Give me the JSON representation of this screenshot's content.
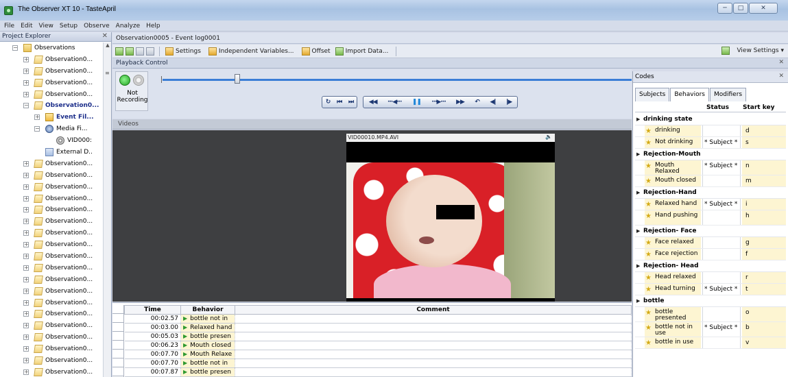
{
  "window": {
    "title": "The Observer XT 10 - TasteApril"
  },
  "menu": [
    "File",
    "Edit",
    "View",
    "Setup",
    "Observe",
    "Analyze",
    "Help"
  ],
  "explorer": {
    "title": "Project Explorer",
    "tree": [
      {
        "label": "Observations",
        "indent": 0,
        "exp": "minus",
        "icon": "folder"
      },
      {
        "label": "Observation0...",
        "indent": 1,
        "exp": "plus",
        "icon": "obs"
      },
      {
        "label": "Observation0...",
        "indent": 1,
        "exp": "plus",
        "icon": "obs"
      },
      {
        "label": "Observation0...",
        "indent": 1,
        "exp": "plus",
        "icon": "obs"
      },
      {
        "label": "Observation0...",
        "indent": 1,
        "exp": "plus",
        "icon": "obs"
      },
      {
        "label": "Observation0...",
        "indent": 1,
        "exp": "minus",
        "icon": "obs",
        "bold": true
      },
      {
        "label": "Event Fil...",
        "indent": 2,
        "exp": "plus",
        "icon": "ev",
        "bold": true
      },
      {
        "label": "Media Fi...",
        "indent": 2,
        "exp": "minus",
        "icon": "media"
      },
      {
        "label": "VID000:",
        "indent": 3,
        "exp": "",
        "icon": "vid"
      },
      {
        "label": "External D..",
        "indent": 2,
        "exp": "",
        "icon": "ext"
      },
      {
        "label": "Observation0...",
        "indent": 1,
        "exp": "plus",
        "icon": "obs"
      },
      {
        "label": "Observation0...",
        "indent": 1,
        "exp": "plus",
        "icon": "obs"
      },
      {
        "label": "Observation0...",
        "indent": 1,
        "exp": "plus",
        "icon": "obs"
      },
      {
        "label": "Observation0...",
        "indent": 1,
        "exp": "plus",
        "icon": "obs"
      },
      {
        "label": "Observation0...",
        "indent": 1,
        "exp": "plus",
        "icon": "obs"
      },
      {
        "label": "Observation0...",
        "indent": 1,
        "exp": "plus",
        "icon": "obs"
      },
      {
        "label": "Observation0...",
        "indent": 1,
        "exp": "plus",
        "icon": "obs"
      },
      {
        "label": "Observation0...",
        "indent": 1,
        "exp": "plus",
        "icon": "obs"
      },
      {
        "label": "Observation0...",
        "indent": 1,
        "exp": "plus",
        "icon": "obs"
      },
      {
        "label": "Observation0...",
        "indent": 1,
        "exp": "plus",
        "icon": "obs"
      },
      {
        "label": "Observation0...",
        "indent": 1,
        "exp": "plus",
        "icon": "obs"
      },
      {
        "label": "Observation0...",
        "indent": 1,
        "exp": "plus",
        "icon": "obs"
      },
      {
        "label": "Observation0...",
        "indent": 1,
        "exp": "plus",
        "icon": "obs"
      },
      {
        "label": "Observation0...",
        "indent": 1,
        "exp": "plus",
        "icon": "obs"
      },
      {
        "label": "Observation0...",
        "indent": 1,
        "exp": "plus",
        "icon": "obs"
      },
      {
        "label": "Observation0...",
        "indent": 1,
        "exp": "plus",
        "icon": "obs"
      },
      {
        "label": "Observation0...",
        "indent": 1,
        "exp": "plus",
        "icon": "obs"
      },
      {
        "label": "Observation0...",
        "indent": 1,
        "exp": "plus",
        "icon": "obs"
      },
      {
        "label": "Observation0...",
        "indent": 1,
        "exp": "plus",
        "icon": "obs"
      }
    ]
  },
  "document": {
    "tab_title": "Observation0005 - Event log0001"
  },
  "toolbar": {
    "settings": "Settings",
    "independent_variables": "Independent Variables...",
    "offset": "Offset",
    "import_data": "Import Data...",
    "view_settings": "View Settings"
  },
  "playback": {
    "title": "Playback Control",
    "recording_status": "Not Recording",
    "position_fraction": 0.16
  },
  "videos": {
    "title": "Videos",
    "file_name": "VID00010.MP4.AVI"
  },
  "event_log": {
    "columns": [
      "Time",
      "Behavior",
      "Comment"
    ],
    "rows": [
      {
        "time": "00:02.57",
        "behavior": "bottle not in"
      },
      {
        "time": "00:03.00",
        "behavior": "Relaxed hand"
      },
      {
        "time": "00:05.03",
        "behavior": "bottle presen"
      },
      {
        "time": "00:06.23",
        "behavior": "Mouth closed"
      },
      {
        "time": "00:07.70",
        "behavior": "Mouth Relaxe"
      },
      {
        "time": "00:07.70",
        "behavior": "bottle not in"
      },
      {
        "time": "00:07.87",
        "behavior": "bottle presen"
      }
    ]
  },
  "codes": {
    "title": "Codes",
    "tabs": [
      "Subjects",
      "Behaviors",
      "Modifiers"
    ],
    "active_tab": "Behaviors",
    "columns": {
      "status": "Status",
      "start_key": "Start key"
    },
    "groups": [
      {
        "name": "drinking state",
        "items": [
          {
            "name": "drinking",
            "status": "",
            "key": "d"
          },
          {
            "name": "Not drinking",
            "status": "* Subject *",
            "key": "s"
          }
        ]
      },
      {
        "name": "Rejection-Mouth",
        "items": [
          {
            "name": "Mouth Relaxed",
            "status": "* Subject *",
            "key": "n",
            "tall": true
          },
          {
            "name": "Mouth closed",
            "status": "",
            "key": "m"
          }
        ]
      },
      {
        "name": "Rejection-Hand",
        "items": [
          {
            "name": "Relaxed hand",
            "status": "* Subject *",
            "key": "i"
          },
          {
            "name": "Hand pushing",
            "status": "",
            "key": "h",
            "tall": true
          }
        ]
      },
      {
        "name": "Rejection- Face",
        "items": [
          {
            "name": "Face relaxed",
            "status": "",
            "key": "g"
          },
          {
            "name": "Face rejection",
            "status": "",
            "key": "f"
          }
        ]
      },
      {
        "name": "Rejection- Head",
        "items": [
          {
            "name": "Head relaxed",
            "status": "",
            "key": "r"
          },
          {
            "name": "Head turning",
            "status": "* Subject *",
            "key": "t"
          }
        ]
      },
      {
        "name": "bottle",
        "items": [
          {
            "name": "bottle presented",
            "status": "",
            "key": "o",
            "tall": true
          },
          {
            "name": "bottle not in use",
            "status": "* Subject *",
            "key": "b",
            "tall": true
          },
          {
            "name": "bottle in use",
            "status": "",
            "key": "v"
          }
        ]
      }
    ]
  }
}
